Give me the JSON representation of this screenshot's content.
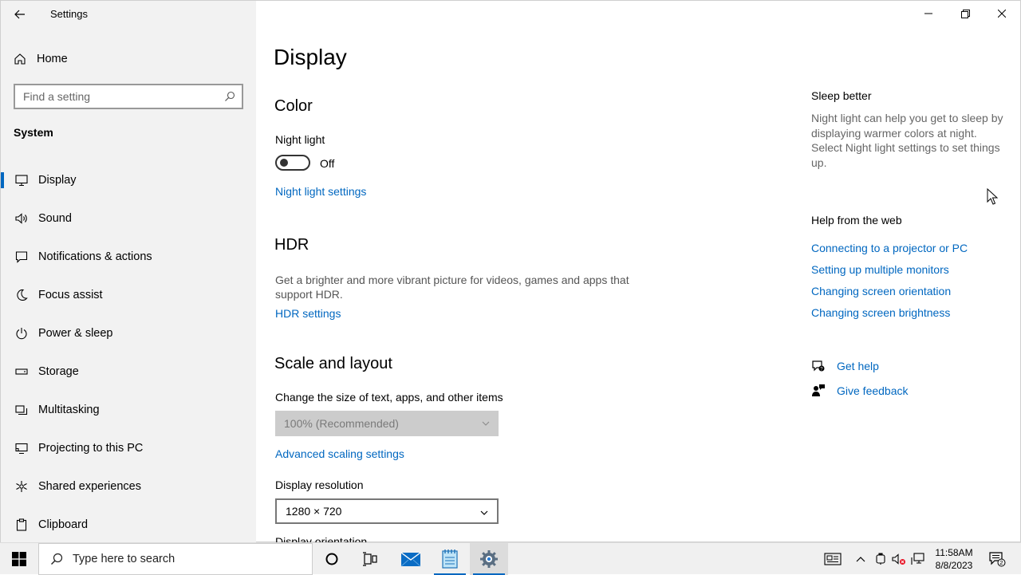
{
  "window": {
    "app_title": "Settings"
  },
  "sidebar": {
    "home_label": "Home",
    "search_placeholder": "Find a setting",
    "section_label": "System",
    "items": [
      {
        "label": "Display",
        "icon": "monitor-icon",
        "active": true
      },
      {
        "label": "Sound",
        "icon": "speaker-icon"
      },
      {
        "label": "Notifications & actions",
        "icon": "notification-icon"
      },
      {
        "label": "Focus assist",
        "icon": "moon-icon"
      },
      {
        "label": "Power & sleep",
        "icon": "power-icon"
      },
      {
        "label": "Storage",
        "icon": "storage-icon"
      },
      {
        "label": "Multitasking",
        "icon": "multitasking-icon"
      },
      {
        "label": "Projecting to this PC",
        "icon": "projecting-icon"
      },
      {
        "label": "Shared experiences",
        "icon": "shared-experiences-icon"
      },
      {
        "label": "Clipboard",
        "icon": "clipboard-icon"
      }
    ]
  },
  "main": {
    "page_title": "Display",
    "color": {
      "heading": "Color",
      "night_light_label": "Night light",
      "night_light_state": "Off",
      "night_light_on": false,
      "night_light_settings_link": "Night light settings"
    },
    "hdr": {
      "heading": "HDR",
      "description": "Get a brighter and more vibrant picture for videos, games and apps that support HDR.",
      "settings_link": "HDR settings"
    },
    "scale": {
      "heading": "Scale and layout",
      "size_label": "Change the size of text, apps, and other items",
      "size_value": "100% (Recommended)",
      "advanced_link": "Advanced scaling settings",
      "resolution_label": "Display resolution",
      "resolution_value": "1280 × 720",
      "orientation_label": "Display orientation"
    }
  },
  "right": {
    "sleep_heading": "Sleep better",
    "sleep_desc": "Night light can help you get to sleep by displaying warmer colors at night. Select Night light settings to set things up.",
    "help_heading": "Help from the web",
    "help_links": [
      "Connecting to a projector or PC",
      "Setting up multiple monitors",
      "Changing screen orientation",
      "Changing screen brightness"
    ],
    "get_help": "Get help",
    "give_feedback": "Give feedback"
  },
  "taskbar": {
    "search_placeholder": "Type here to search",
    "time": "11:58AM",
    "date": "8/8/2023",
    "notification_count": "2"
  },
  "colors": {
    "accent": "#0067c0",
    "sidebar_bg": "#f2f2f2"
  }
}
